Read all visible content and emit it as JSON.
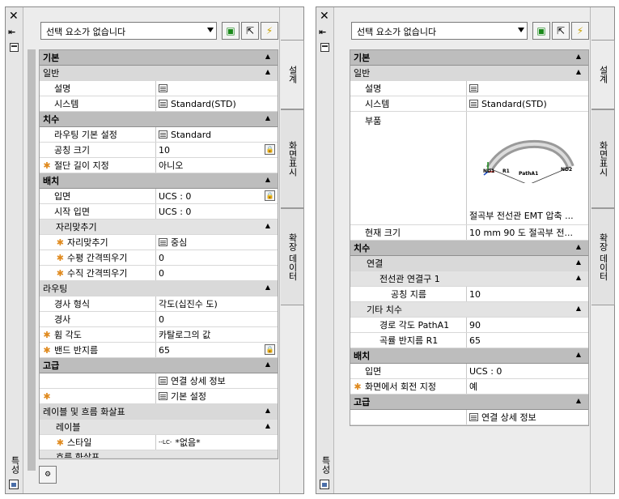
{
  "colors": {
    "category_bg": "#bdbdbd",
    "subcategory_bg": "#d9d9d9",
    "marker": "#e08a1e",
    "panel_bg": "#ececec"
  },
  "icons": [
    "close-icon",
    "dock-icon",
    "menu-icon",
    "select-objects-icon",
    "pick-icon",
    "quick-select-icon",
    "lock-icon",
    "table-icon"
  ],
  "left": {
    "title": "특성",
    "select": "선택 요소가 없습니다",
    "tabs": [
      "설계",
      "화면표시",
      "확장 데이터"
    ],
    "sections": {
      "basic": "기본",
      "general": "일반",
      "desc": "설명",
      "system": "시스템",
      "system_val": "Standard(STD)",
      "dims": "치수",
      "routing_pref": "라우팅 기본 설정",
      "routing_pref_val": "Standard",
      "nominal": "공칭 크기",
      "nominal_val": "10",
      "cut_length": "절단 길이 지정",
      "cut_length_val": "아니오",
      "placement": "배치",
      "elevation": "입면",
      "elevation_val": "UCS : 0",
      "start_elev": "시작 입면",
      "start_elev_val": "UCS : 0",
      "justify": "자리맞추기",
      "justify2": "자리맞추기",
      "justify_val": "중심",
      "hspace": "수평 간격띄우기",
      "hspace_val": "0",
      "vspace": "수직 간격띄우기",
      "vspace_val": "0",
      "routing": "라우팅",
      "slope_form": "경사 형식",
      "slope_form_val": "각도(십진수 도)",
      "slope": "경사",
      "slope_val": "0",
      "bend_angle": "휨 각도",
      "bend_angle_val": "카탈로그의 값",
      "bend_radius": "밴드 반지름",
      "bend_radius_val": "65",
      "advanced": "고급",
      "conn_details": "연결 상세 정보",
      "default_settings": "기본 설정",
      "labels_flow": "레이블 및 흐름 화살표",
      "labels": "레이블",
      "style": "스타일",
      "style_val": "*없음*",
      "flow": "흐름 화살표"
    }
  },
  "right": {
    "title": "특성",
    "select": "선택 요소가 없습니다",
    "tabs": [
      "설계",
      "화면표시",
      "확장 데이터"
    ],
    "sections": {
      "basic": "기본",
      "general": "일반",
      "desc": "설명",
      "system": "시스템",
      "system_val": "Standard(STD)",
      "part": "부품",
      "part_caption": "절곡부 전선관 EMT 압축 ...",
      "nd1": "ND1",
      "r1": "R1",
      "patha1": "PathA1",
      "nd2": "ND2",
      "current_size": "현재 크기",
      "current_size_val": "10 mm 90 도 절곡부 전...",
      "dims": "치수",
      "connection": "연결",
      "conduit_conn": "전선관 연결구 1",
      "nominal_dia": "공칭 지름",
      "nominal_dia_val": "10",
      "other_dims": "기타 치수",
      "path_angle": "경로 각도 PathA1",
      "path_angle_val": "90",
      "bend_radius": "곡률 반지름 R1",
      "bend_radius_val": "65",
      "placement": "배치",
      "elevation": "입면",
      "elevation_val": "UCS : 0",
      "rotation": "화면에서 회전 지정",
      "rotation_val": "예",
      "advanced": "고급",
      "conn_details": "연결 상세 정보"
    }
  }
}
